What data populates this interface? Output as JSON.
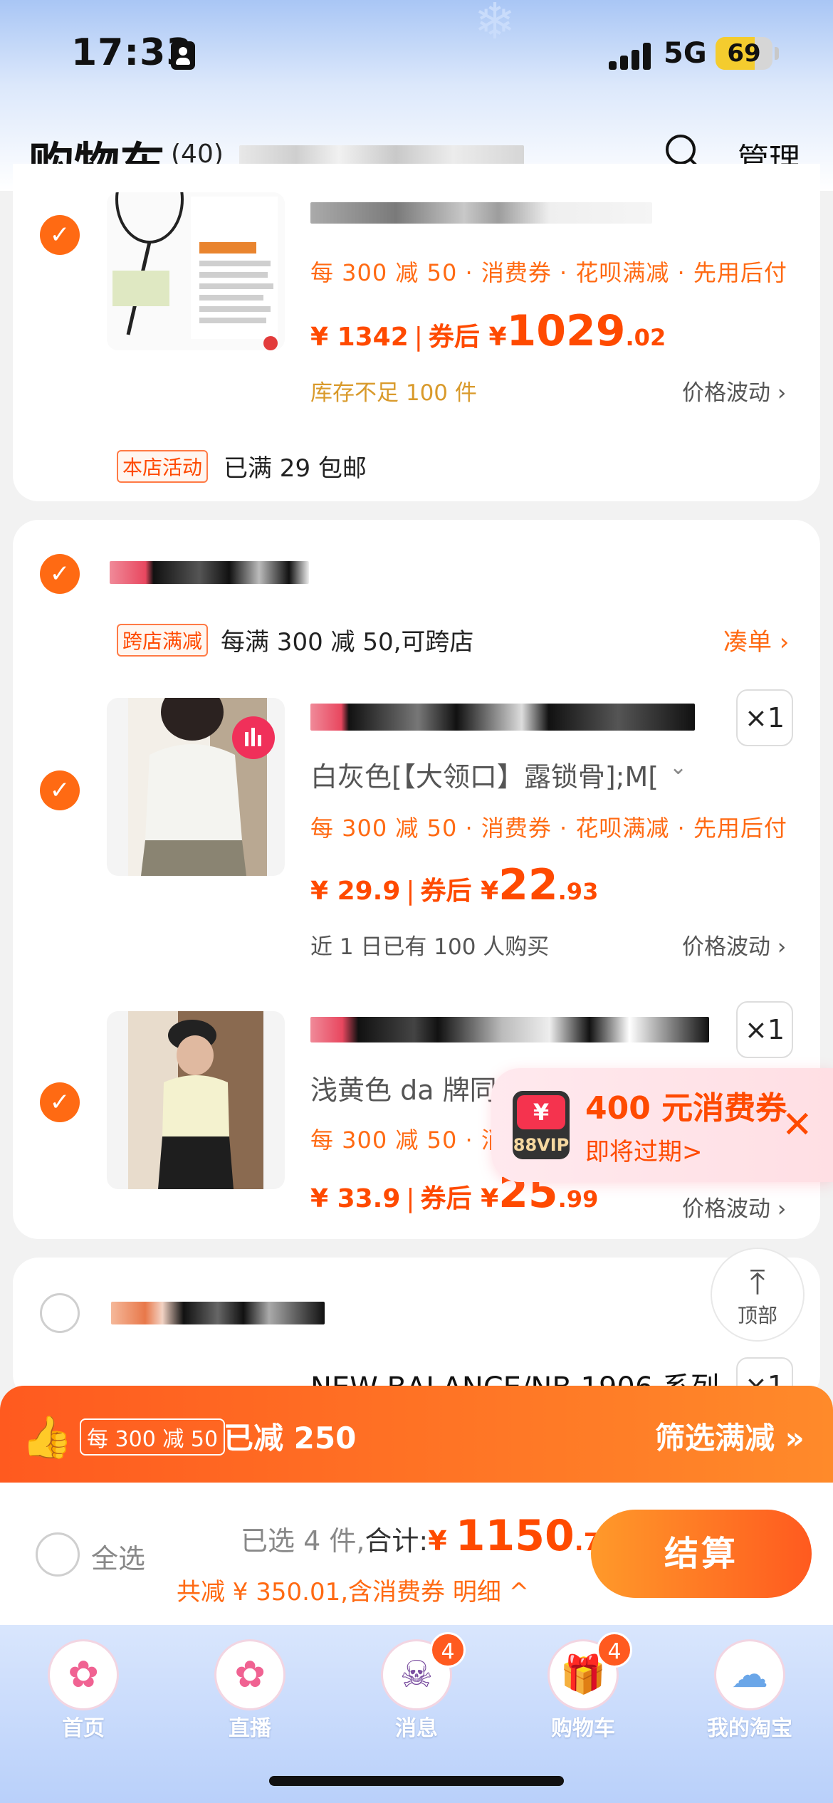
{
  "status_bar": {
    "time": "17:33",
    "network": "5G",
    "battery": "69",
    "battery_level": 0.69
  },
  "header": {
    "title": "购物车",
    "count": "(40)",
    "manage_label": "管理"
  },
  "colors": {
    "accent": "#ff4a00",
    "orange": "#ff6a13",
    "stock_warning": "#d99a2b"
  },
  "stores": [
    {
      "checked": true,
      "items": [
        {
          "promo": "每 300 减 50 · 消费券 · 花呗满减 · 先用后付",
          "price": "¥ 1342",
          "after_label": "券后 ¥",
          "after_int": "1029",
          "after_dec": ".02",
          "note": "库存不足 100 件",
          "fluct": "价格波动 ›"
        }
      ],
      "activity_tag": "本店活动",
      "activity_text": "已满 29 包邮"
    },
    {
      "checked": true,
      "cross_tag": "跨店满减",
      "cross_text": "每满 300 减 50,可跨店",
      "cross_action": "凑单 ›",
      "items": [
        {
          "qty": "×1",
          "sku": "白灰色[【大领口】露锁骨];M[",
          "promo": "每 300 减 50 · 消费券 · 花呗满减 · 先用后付",
          "price": "¥ 29.9",
          "after_label": "券后 ¥",
          "after_int": "22",
          "after_dec": ".93",
          "note": "近 1 日已有 100 人购买",
          "fluct": "价格波动 ›"
        },
        {
          "qty": "×1",
          "sku": "浅黄色 da 牌同款",
          "promo": "每 300 减 50 · 消费",
          "price": "¥ 33.9",
          "after_label": "券后 ¥",
          "after_int": "25",
          "after_dec": ".99",
          "fluct": "价格波动 ›"
        }
      ]
    },
    {
      "checked": false,
      "items": [
        {
          "title": "NEW BALANCE/NB 1906 系列",
          "qty": "×1"
        }
      ]
    }
  ],
  "coupon_popup": {
    "vip_label": "88VIP",
    "vip_symbol": "¥",
    "amount": "400 元消费券",
    "sub": "即将过期>"
  },
  "back_to_top": "顶部",
  "discount_bar": {
    "tag": "每 300 减 50",
    "saved": "已减 250",
    "filter": "筛选满减 »"
  },
  "checkout": {
    "select_all": "全选",
    "selected_prefix": "已选 4 件,",
    "total_label": "合计:",
    "currency": "¥",
    "total_int": "1150",
    "total_dec": ".79",
    "saved_line": "共减 ¥ 350.01,含消费券  明细 ^",
    "button": "结算"
  },
  "tabs": [
    {
      "label": "首页",
      "icon": "hello-kitty-icon",
      "badge": ""
    },
    {
      "label": "直播",
      "icon": "hello-kitty-icon",
      "badge": ""
    },
    {
      "label": "消息",
      "icon": "kuromi-icon",
      "badge": "4"
    },
    {
      "label": "购物车",
      "icon": "gift-box-icon",
      "badge": "4"
    },
    {
      "label": "我的淘宝",
      "icon": "cinnamoroll-icon",
      "badge": ""
    }
  ]
}
